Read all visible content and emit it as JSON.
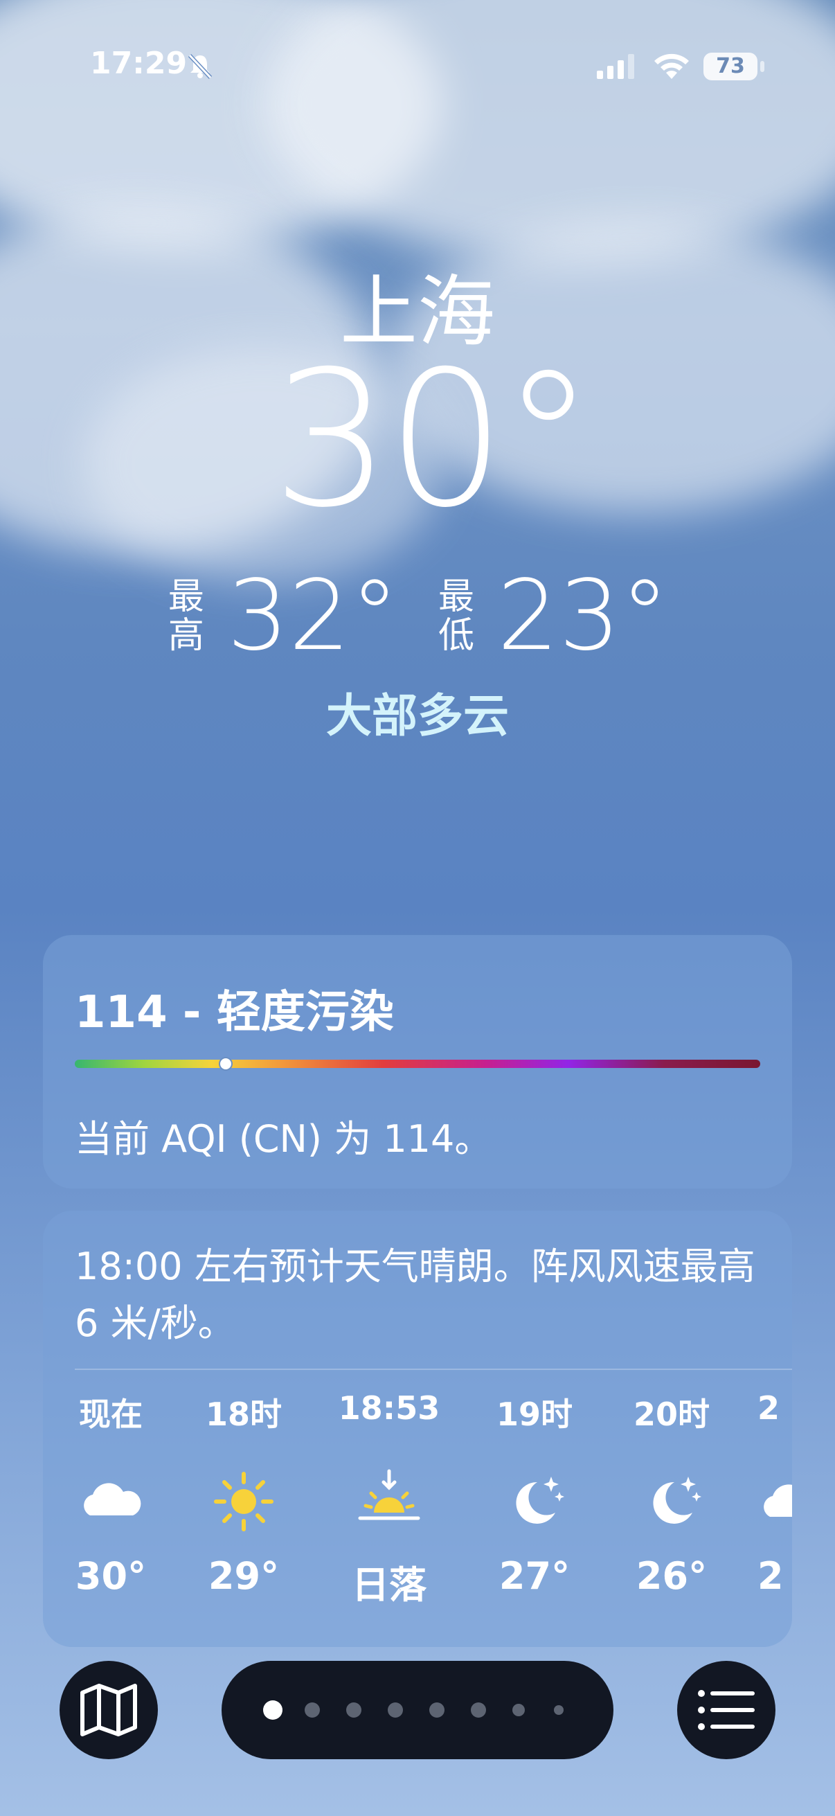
{
  "status_bar": {
    "time": "17:29",
    "battery": "73",
    "icons": [
      "bell-slash-icon",
      "signal-icon",
      "wifi-icon",
      "battery-icon"
    ]
  },
  "location": {
    "city": "上海",
    "temperature": "30°",
    "high_label": "最高",
    "high": "32°",
    "low_label": "最低",
    "low": "23°",
    "condition": "大部多云"
  },
  "aqi": {
    "title": "114 - 轻度污染",
    "description": "当前 AQI (CN) 为 114。",
    "level_fraction": 0.22
  },
  "hourly": {
    "summary": "18:00 左右预计天气晴朗。阵风风速最高 6 米/秒。",
    "items": [
      {
        "time": "现在",
        "icon": "cloud-icon",
        "value": "30°"
      },
      {
        "time": "18时",
        "icon": "sun-icon",
        "value": "29°"
      },
      {
        "time": "18:53",
        "icon": "sunset-icon",
        "value": "日落"
      },
      {
        "time": "19时",
        "icon": "moon-stars-icon",
        "value": "27°"
      },
      {
        "time": "20时",
        "icon": "moon-stars-icon",
        "value": "26°"
      },
      {
        "time": "2",
        "icon": "cloud-moon-icon",
        "value": "2"
      }
    ]
  },
  "bottom_bar": {
    "map_icon": "map-icon",
    "list_icon": "list-icon",
    "page_count": 8,
    "active_page": 1
  },
  "colors": {
    "condition_text": "#d4f3fb",
    "bar_bg": "#121723",
    "sun": "#f7d23a"
  }
}
